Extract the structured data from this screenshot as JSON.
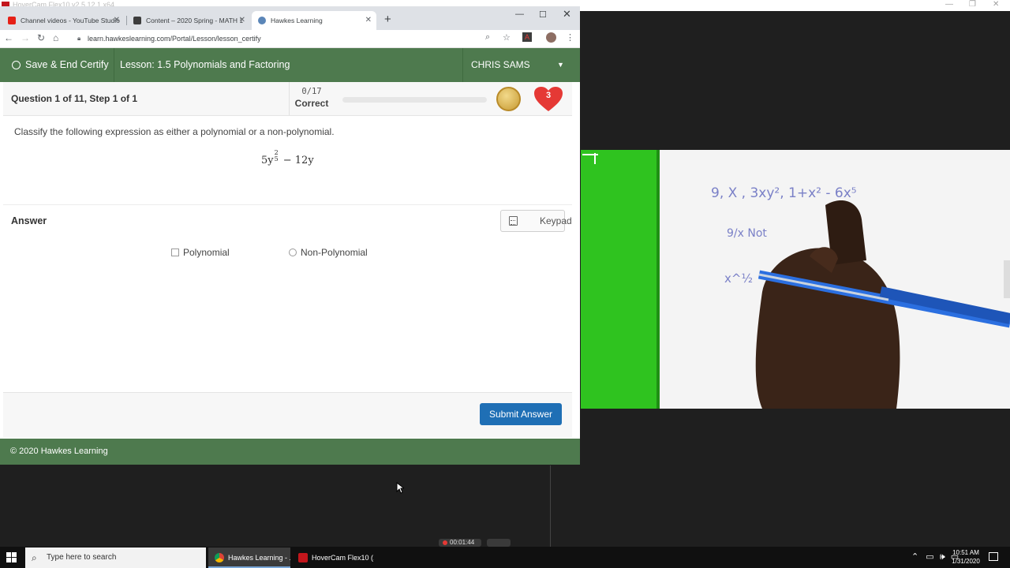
{
  "hovercam": {
    "title": "HoverCam Flex10 v2.5.12.1 x64"
  },
  "browser": {
    "tabs": [
      {
        "label": "Channel videos - YouTube Studio",
        "icon": "youtube-icon"
      },
      {
        "label": "Content – 2020 Spring - MATH 1",
        "icon": "bb-icon"
      },
      {
        "label": "Hawkes Learning",
        "icon": "hawkes-icon",
        "active": true
      }
    ],
    "url": "learn.hawkeslearning.com/Portal/Lesson/lesson_certify"
  },
  "app": {
    "save_end_label": "Save & End Certify",
    "lesson_label": "Lesson: 1.5 Polynomials and Factoring",
    "user_name": "CHRIS SAMS"
  },
  "question": {
    "title": "Question 1 of 11, Step 1 of 1",
    "score_fraction": "0/17",
    "score_label": "Correct",
    "progress_fraction": 0,
    "lives": "3",
    "prompt": "Classify the following expression as either a polynomial or a non-polynomial.",
    "expression": {
      "coef": "5y",
      "exp_num": "2",
      "exp_den": "5",
      "rest": " − 12y"
    }
  },
  "answer": {
    "label": "Answer",
    "keypad_label": "Keypad",
    "options": [
      {
        "label": "Polynomial",
        "type": "checkbox"
      },
      {
        "label": "Non-Polynomial",
        "type": "radio"
      }
    ],
    "submit_label": "Submit Answer"
  },
  "footer": {
    "copyright": "© 2020 Hawkes Learning"
  },
  "camera": {
    "handwriting": [
      "9,  X ,   3xy²,   1+x² - 6x⁵",
      "9/x  Not",
      "x^½"
    ]
  },
  "recording": {
    "time": "00:01:44"
  },
  "taskbar": {
    "search_placeholder": "Type here to search",
    "tasks": [
      {
        "label": "Hawkes Learning - ...",
        "icon": "chrome-icon",
        "active": true
      },
      {
        "label": "HoverCam Flex10 (...",
        "icon": "flex10-icon",
        "active": false
      }
    ],
    "time": "10:51 AM",
    "date": "1/31/2020"
  },
  "colors": {
    "brand_green": "#4e7a4e",
    "submit_blue": "#1f6fb5",
    "heart_red": "#e53935",
    "green_screen": "#2fc31f"
  }
}
